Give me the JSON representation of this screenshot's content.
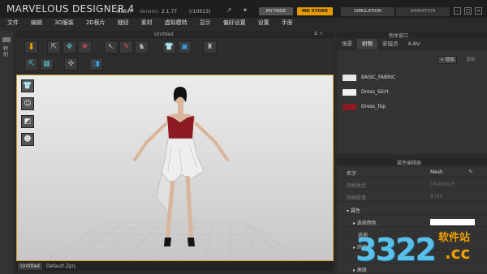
{
  "app": {
    "title": "MARVELOUS DESIGNER 4",
    "greeting": "Hello!",
    "version_label": "Version:",
    "version": "2.1.77",
    "build": "(r10013)",
    "my_page": "MY PAGE",
    "md_store": "MD STORE",
    "mode_simulation": "SIMULATION",
    "mode_animation": "ANIMATION"
  },
  "menu": [
    "文件",
    "编辑",
    "3D服装",
    "2D板片",
    "缝纫",
    "素材",
    "虚拟模特",
    "显示",
    "偏好设置",
    "设置",
    "手册"
  ],
  "left_strip": {
    "label": "特别"
  },
  "view": {
    "title": "Untitled",
    "bottom_tabs": [
      "Untitled",
      "Default.Zprj"
    ]
  },
  "object_browser": {
    "title": "物体窗口",
    "tabs": [
      "场景",
      "织物",
      "安钮点",
      "A-BV"
    ],
    "active_tab": 1,
    "add_label": "+ 增加",
    "copy_label": "复制",
    "fabrics": [
      {
        "name": "BASIC_FABRIC",
        "color": "#e6e6e6"
      },
      {
        "name": "Dress_Skirt",
        "color": "#f0f0f0"
      },
      {
        "name": "Dress_Top",
        "color": "#8b1a22"
      }
    ]
  },
  "property_editor": {
    "title": "属性编辑器",
    "rows": [
      {
        "label": "名字",
        "value": "Mesh",
        "dim": false
      },
      {
        "label": "网格类型",
        "value": "TRIANGLE",
        "dim": true
      },
      {
        "label": "网格数量",
        "value": "8769",
        "dim": true
      },
      {
        "label": "▾ 属性",
        "value": "",
        "dim": false
      },
      {
        "label": "▸ 选择颜色",
        "value": "",
        "dim": false
      },
      {
        "label": "选项",
        "value": "",
        "dim": false
      },
      {
        "label": "▸ 环境",
        "value": "",
        "dim": false
      },
      {
        "label": "环境",
        "value": "",
        "dim": true
      },
      {
        "label": "▸ 高级",
        "value": "",
        "dim": false
      }
    ]
  },
  "watermark": {
    "number": "3322",
    "site": "软件站",
    "tld": ".cc"
  },
  "colors": {
    "accent": "#e49a00",
    "viewport_border": "#d4a030",
    "dress_top": "#8b1a22"
  }
}
